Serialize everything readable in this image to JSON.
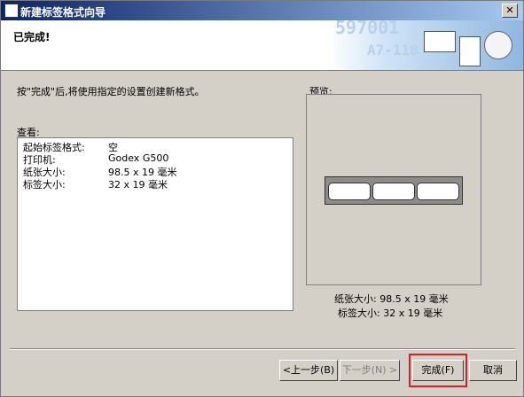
{
  "window": {
    "title": "新建标签格式向导"
  },
  "header": {
    "heading": "已完成!",
    "banner_numbers": [
      "597001",
      "A7-118"
    ]
  },
  "main": {
    "instruction": "按\"完成\"后,将使用指定的设置创建新格式。",
    "view_label": "查看:",
    "summary": [
      {
        "key": "起始标签格式:",
        "value": "空"
      },
      {
        "key": "打印机:",
        "value": "Godex G500"
      },
      {
        "key": "纸张大小:",
        "value": "98.5 x 19  毫米"
      },
      {
        "key": "标签大小:",
        "value": "32 x 19  毫米"
      }
    ]
  },
  "preview": {
    "label": "预览:",
    "paper_size": "纸张大小: 98.5 x 19  毫米",
    "label_size": "标签大小: 32 x 19  毫米"
  },
  "buttons": {
    "back": "<上一步(B)",
    "next": "下一步(N) >",
    "finish": "完成(F)",
    "cancel": "取消"
  },
  "close_glyph": "✕",
  "accent_colors": {
    "titlebar": "#0a246a",
    "highlight": "#e02020"
  }
}
